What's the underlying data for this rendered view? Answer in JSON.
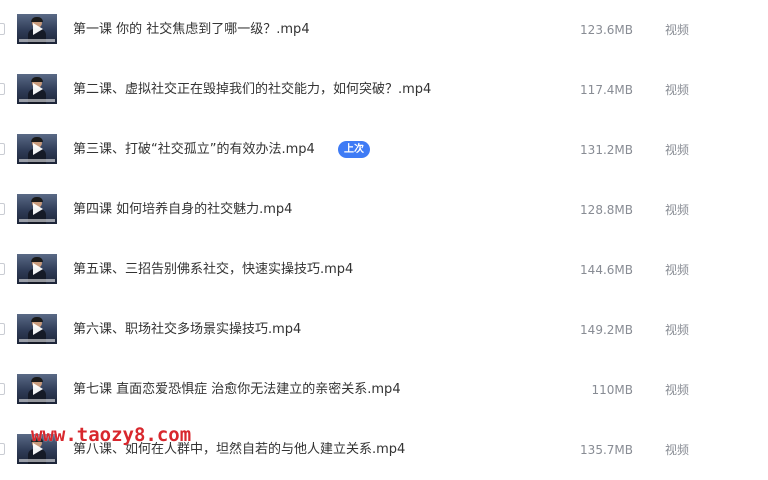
{
  "files": [
    {
      "name": "第一课 你的 社交焦虑到了哪一级？.mp4",
      "size": "123.6MB",
      "type": "视频",
      "thumb_icon": "video-thumbnail-icon"
    },
    {
      "name": "第二课、虚拟社交正在毁掉我们的社交能力，如何突破？.mp4",
      "size": "117.4MB",
      "type": "视频",
      "thumb_icon": "video-thumbnail-icon"
    },
    {
      "name": "第三课、打破“社交孤立”的有效办法.mp4",
      "size": "131.2MB",
      "type": "视频",
      "badge": "上次",
      "thumb_icon": "video-thumbnail-icon"
    },
    {
      "name": "第四课 如何培养自身的社交魅力.mp4",
      "size": "128.8MB",
      "type": "视频",
      "thumb_icon": "video-thumbnail-icon"
    },
    {
      "name": "第五课、三招告别佛系社交，快速实操技巧.mp4",
      "size": "144.6MB",
      "type": "视频",
      "thumb_icon": "video-thumbnail-icon"
    },
    {
      "name": "第六课、职场社交多场景实操技巧.mp4",
      "size": "149.2MB",
      "type": "视频",
      "thumb_icon": "video-thumbnail-icon"
    },
    {
      "name": "第七课 直面恋爱恐惧症 治愈你无法建立的亲密关系.mp4",
      "size": "110MB",
      "type": "视频",
      "thumb_icon": "video-thumbnail-icon"
    },
    {
      "name": "第八课、如何在人群中，坦然自若的与他人建立关系.mp4",
      "size": "135.7MB",
      "type": "视频",
      "thumb_icon": "video-thumbnail-icon"
    }
  ],
  "watermark": "www.taozy8.com",
  "colors": {
    "badge": "#3e7bf5",
    "watermark": "#d8272d",
    "muted_text": "#888c94"
  }
}
